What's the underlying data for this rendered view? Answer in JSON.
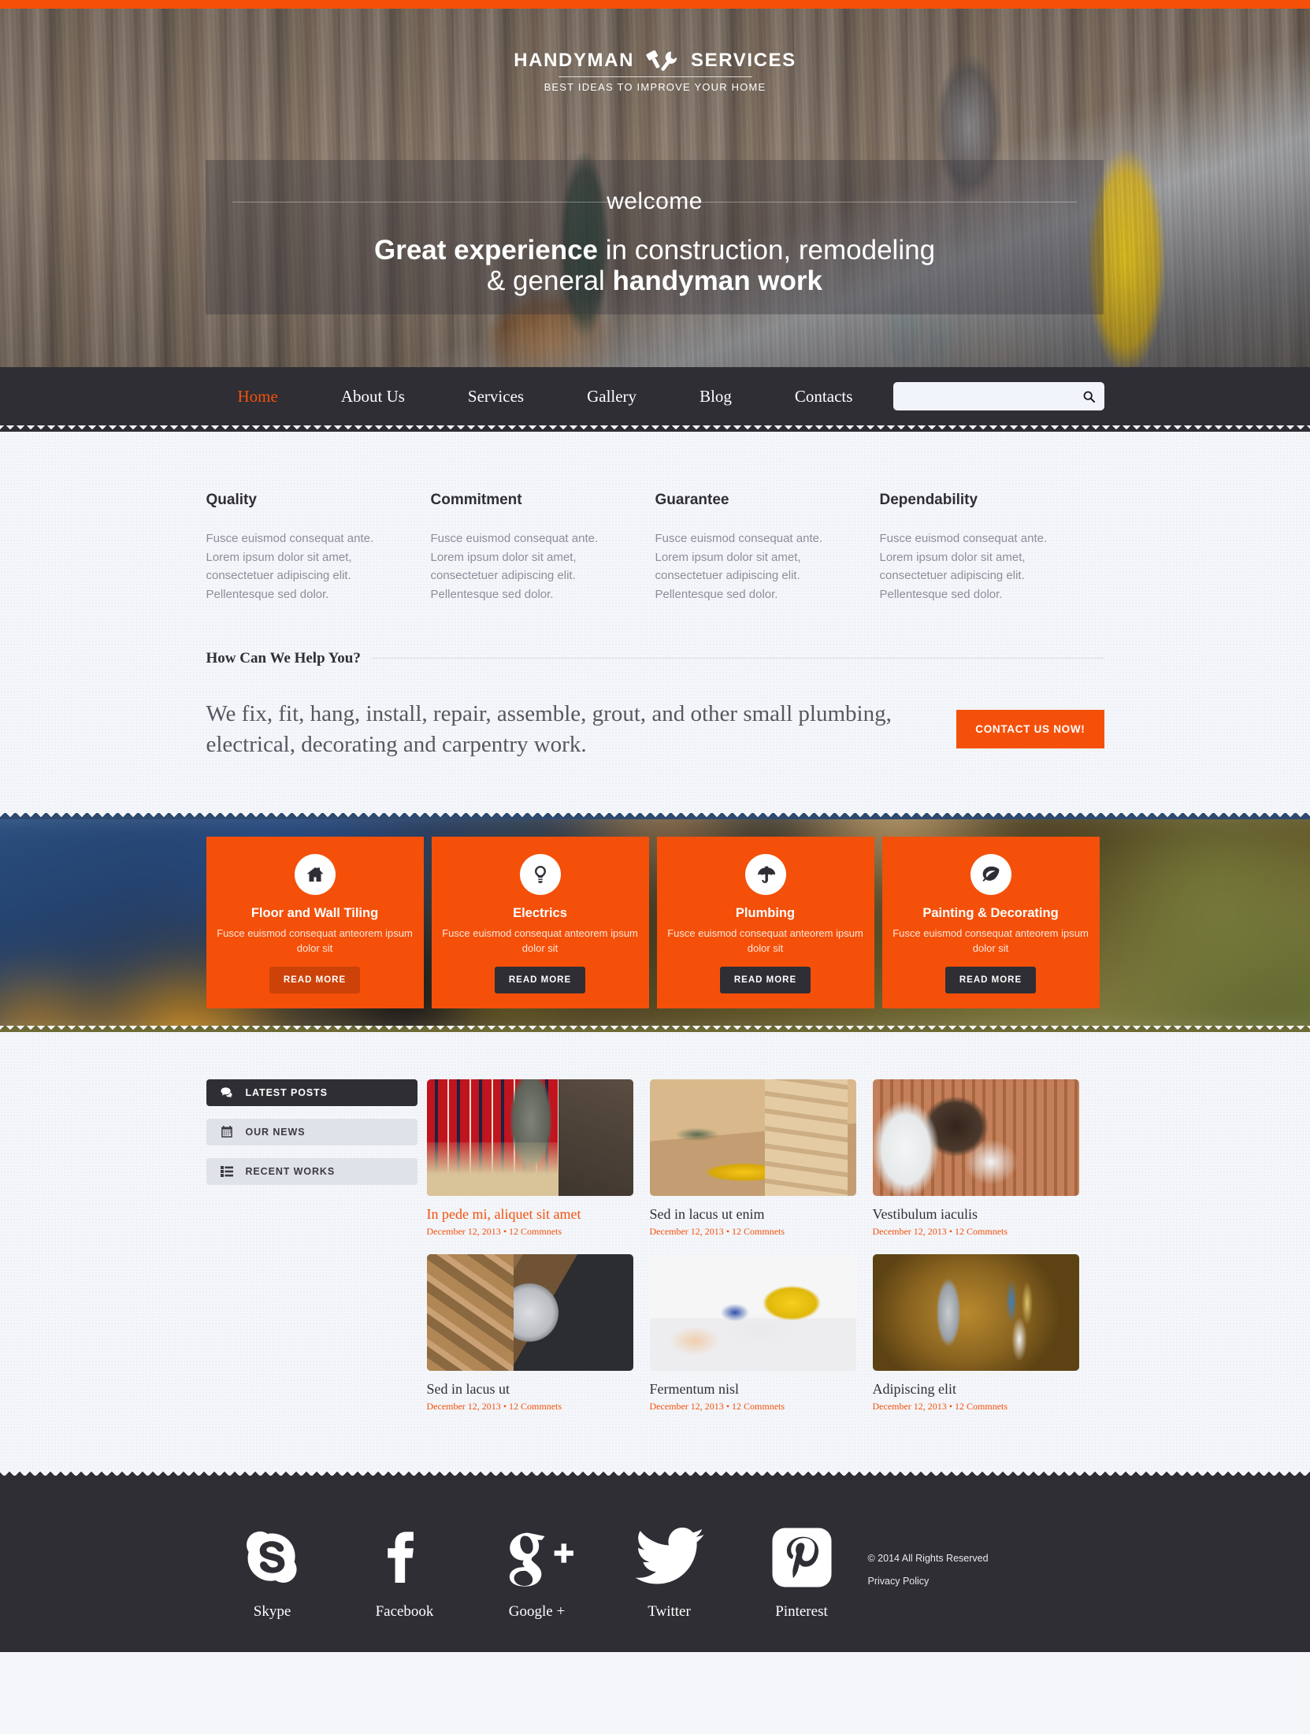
{
  "brand": {
    "name_left": "HANDYMAN",
    "name_right": "SERVICES",
    "tagline": "BEST IDEAS TO IMPROVE YOUR HOME",
    "accent_color": "#f4500a",
    "dark_color": "#2f2e35"
  },
  "hero": {
    "welcome": "welcome",
    "headline_bold_1": "Great experience",
    "headline_rest_1": " in construction, remodeling",
    "headline_rest_2": "& general ",
    "headline_bold_2": "handyman work"
  },
  "nav": {
    "items": [
      {
        "label": "Home",
        "active": true
      },
      {
        "label": "About Us",
        "active": false
      },
      {
        "label": "Services",
        "active": false
      },
      {
        "label": "Gallery",
        "active": false
      },
      {
        "label": "Blog",
        "active": false
      },
      {
        "label": "Contacts",
        "active": false
      }
    ],
    "search": {
      "value": "",
      "placeholder": ""
    }
  },
  "features": [
    {
      "title": "Quality",
      "text": "Fusce euismod consequat ante. Lorem ipsum dolor sit amet, consectetuer adipiscing elit. Pellentesque sed dolor."
    },
    {
      "title": "Commitment",
      "text": "Fusce euismod consequat ante. Lorem ipsum dolor sit amet, consectetuer adipiscing elit. Pellentesque sed dolor."
    },
    {
      "title": "Guarantee",
      "text": "Fusce euismod consequat ante. Lorem ipsum dolor sit amet, consectetuer adipiscing elit. Pellentesque sed dolor."
    },
    {
      "title": "Dependability",
      "text": "Fusce euismod consequat ante. Lorem ipsum dolor sit amet, consectetuer adipiscing elit. Pellentesque sed dolor."
    }
  ],
  "help": {
    "heading": "How Can We Help You?",
    "body": "We fix, fit, hang, install, repair, assemble, grout, and other small plumbing, electrical, decorating and carpentry work.",
    "cta_label": "CONTACT US NOW!"
  },
  "services": [
    {
      "title": "Floor and Wall Tiling",
      "text": "Fusce euismod consequat anteorem ipsum dolor sit",
      "button": "READ MORE",
      "icon": "home-icon",
      "button_hot": true
    },
    {
      "title": "Electrics",
      "text": "Fusce euismod consequat anteorem ipsum dolor sit",
      "button": "READ MORE",
      "icon": "lightbulb-icon",
      "button_hot": false
    },
    {
      "title": "Plumbing",
      "text": "Fusce euismod consequat anteorem ipsum dolor sit",
      "button": "READ MORE",
      "icon": "umbrella-icon",
      "button_hot": false
    },
    {
      "title": "Painting & Decorating",
      "text": "Fusce euismod consequat anteorem ipsum dolor sit",
      "button": "READ MORE",
      "icon": "leaf-icon",
      "button_hot": false
    }
  ],
  "blog": {
    "tabs": [
      {
        "label": "LATEST POSTS",
        "icon": "comment-icon",
        "active": true
      },
      {
        "label": "OUR NEWS",
        "icon": "calendar-icon",
        "active": false
      },
      {
        "label": "RECENT WORKS",
        "icon": "list-icon",
        "active": false
      }
    ],
    "posts": [
      {
        "title": "In pede mi, aliquet sit amet",
        "date": "December 12, 2013",
        "comments": "12 Commnets",
        "highlight": true,
        "image": "man-drilling-wood-photo"
      },
      {
        "title": "Sed in lacus ut enim",
        "date": "December 12, 2013",
        "comments": "12 Commnets",
        "highlight": false,
        "image": "carpenter-pencil-wood-photo"
      },
      {
        "title": "Vestibulum iaculis",
        "date": "December 12, 2013",
        "comments": "12 Commnets",
        "highlight": false,
        "image": "electrician-wall-socket-photo"
      },
      {
        "title": "Sed in lacus ut",
        "date": "December 12, 2013",
        "comments": "12 Commnets",
        "highlight": false,
        "image": "circular-saw-blade-photo"
      },
      {
        "title": "Fermentum nisl",
        "date": "December 12, 2013",
        "comments": "12 Commnets",
        "highlight": false,
        "image": "electrical-outlet-repair-photo"
      },
      {
        "title": "Adipiscing elit",
        "date": "December 12, 2013",
        "comments": "12 Commnets",
        "highlight": false,
        "image": "wire-cutter-cables-photo"
      }
    ],
    "meta_separator": "•"
  },
  "footer": {
    "socials": [
      {
        "label": "Skype",
        "icon": "skype-icon"
      },
      {
        "label": "Facebook",
        "icon": "facebook-icon"
      },
      {
        "label": "Google +",
        "icon": "google-plus-icon"
      },
      {
        "label": "Twitter",
        "icon": "twitter-icon"
      },
      {
        "label": "Pinterest",
        "icon": "pinterest-icon"
      }
    ],
    "copyright": "© 2014 All Rights Reserved",
    "privacy": "Privacy Policy"
  }
}
